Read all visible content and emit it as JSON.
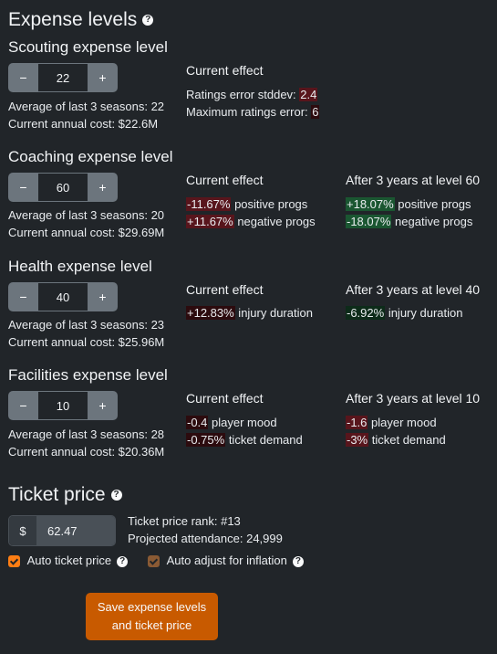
{
  "expense_title": "Expense levels",
  "help_glyph": "?",
  "sections": [
    {
      "title": "Scouting expense level",
      "value": "22",
      "minus": "−",
      "plus": "+",
      "average": "Average of last 3 seasons: 22",
      "cost": "Current annual cost: $22.6M",
      "current_head": "Current effect",
      "current": [
        {
          "pre": "Ratings error stddev: ",
          "val": "2.4",
          "post": ""
        },
        {
          "pre": "Maximum ratings error: ",
          "val": "6",
          "post": ""
        }
      ]
    },
    {
      "title": "Coaching expense level",
      "value": "60",
      "minus": "−",
      "plus": "+",
      "average": "Average of last 3 seasons: 20",
      "cost": "Current annual cost: $29.69M",
      "current_head": "Current effect",
      "current": [
        {
          "val": "-11.67%",
          "post": " positive progs"
        },
        {
          "val": "+11.67%",
          "post": " negative progs"
        }
      ],
      "future_head": "After 3 years at level 60",
      "future": [
        {
          "val": "+18.07%",
          "post": " positive progs"
        },
        {
          "val": "-18.07%",
          "post": " negative progs"
        }
      ]
    },
    {
      "title": "Health expense level",
      "value": "40",
      "minus": "−",
      "plus": "+",
      "average": "Average of last 3 seasons: 23",
      "cost": "Current annual cost: $25.96M",
      "current_head": "Current effect",
      "current": [
        {
          "val": "+12.83%",
          "post": " injury duration"
        }
      ],
      "future_head": "After 3 years at level 40",
      "future": [
        {
          "val": "-6.92%",
          "post": " injury duration"
        }
      ]
    },
    {
      "title": "Facilities expense level",
      "value": "10",
      "minus": "−",
      "plus": "+",
      "average": "Average of last 3 seasons: 28",
      "cost": "Current annual cost: $20.36M",
      "current_head": "Current effect",
      "current": [
        {
          "val": "-0.4",
          "post": " player mood"
        },
        {
          "val": "-0.75%",
          "post": " ticket demand"
        }
      ],
      "future_head": "After 3 years at level 10",
      "future": [
        {
          "val": "-1.6",
          "post": " player mood"
        },
        {
          "val": "-3%",
          "post": " ticket demand"
        }
      ]
    }
  ],
  "ticket": {
    "title": "Ticket price",
    "currency": "$",
    "price": "62.47",
    "rank": "Ticket price rank: #13",
    "attendance": "Projected attendance: 24,999",
    "auto_price_label": "Auto ticket price",
    "auto_inflation_label": "Auto adjust for inflation"
  },
  "colors": {
    "accent": "#c85a00",
    "checkbox_on": "#fd7e14",
    "checkbox_disabled": "#8a5a34",
    "negative": "#58151c",
    "positive": "#1a5631"
  },
  "save_button": {
    "line1": "Save expense levels",
    "line2": "and ticket price"
  }
}
